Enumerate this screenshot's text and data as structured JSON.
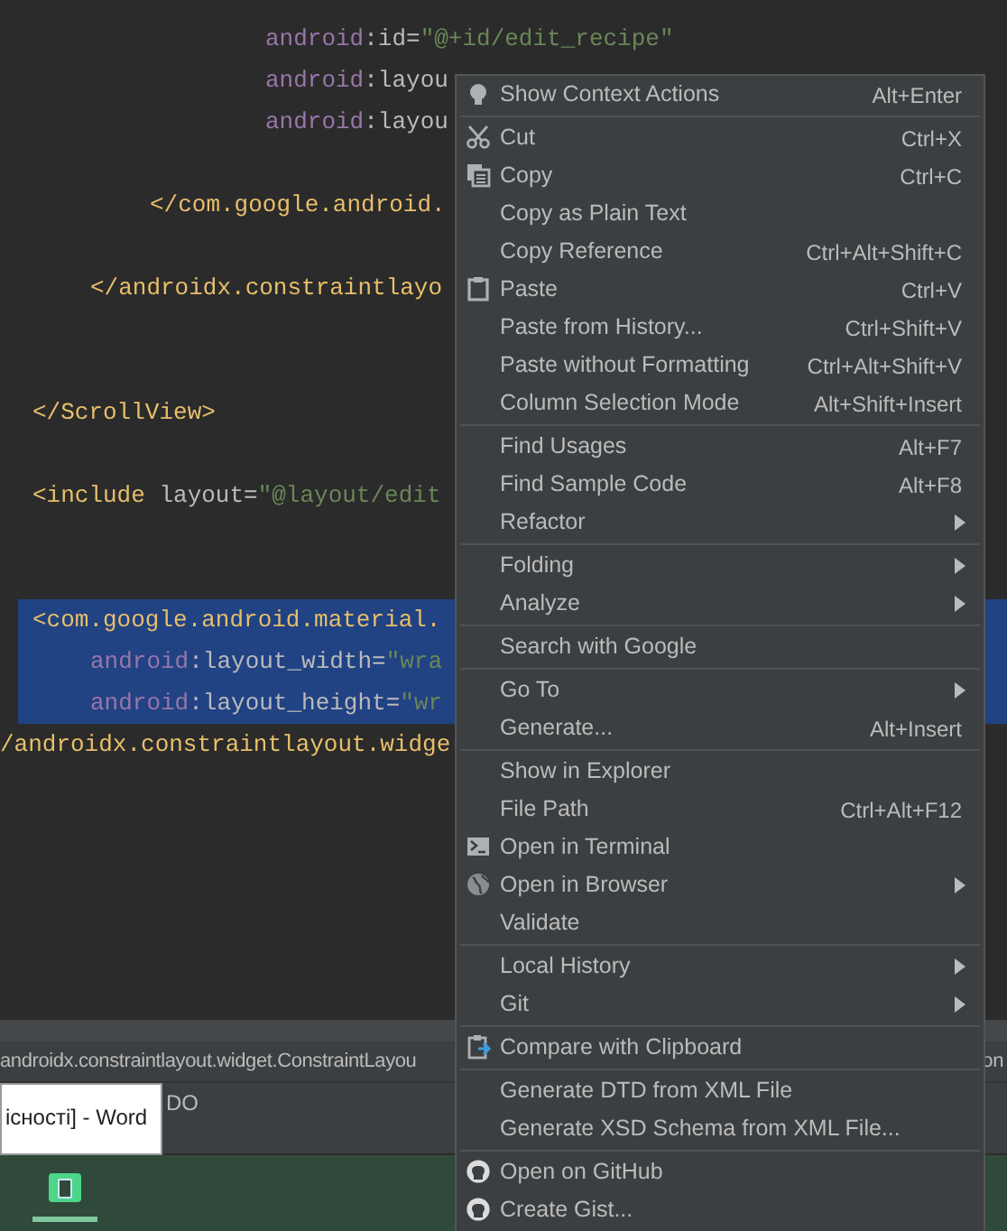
{
  "editor": {
    "lines": [
      {
        "tokens": [
          {
            "kind": "ns",
            "text": "android"
          },
          {
            "kind": "attr",
            "text": ":id="
          },
          {
            "kind": "value",
            "text": "\"@+id/edit_recipe\""
          }
        ],
        "selected": false
      },
      {
        "tokens": [
          {
            "kind": "ns",
            "text": "android"
          },
          {
            "kind": "attr",
            "text": ":layou"
          }
        ],
        "selected": false
      },
      {
        "tokens": [
          {
            "kind": "ns",
            "text": "android"
          },
          {
            "kind": "attr",
            "text": ":layou"
          }
        ],
        "selected": false
      },
      {
        "tokens": [
          {
            "kind": "tag",
            "text": "</com.google.android."
          }
        ],
        "selected": false
      },
      {
        "tokens": [
          {
            "kind": "tag",
            "text": "</androidx.constraintlayo"
          }
        ],
        "selected": false
      },
      {
        "tokens": [
          {
            "kind": "tag",
            "text": "</ScrollView>"
          }
        ],
        "selected": false
      },
      {
        "tokens": [
          {
            "kind": "tag",
            "text": "<include "
          },
          {
            "kind": "attr",
            "text": "layout="
          },
          {
            "kind": "value",
            "text": "\"@layout/edit"
          }
        ],
        "selected": false
      },
      {
        "tokens": [
          {
            "kind": "tag",
            "text": "<com.google.android.material."
          }
        ],
        "selected": true
      },
      {
        "tokens": [
          {
            "kind": "ns",
            "text": "android"
          },
          {
            "kind": "attr",
            "text": ":layout_width="
          },
          {
            "kind": "value",
            "text": "\"wra"
          }
        ],
        "selected": true
      },
      {
        "tokens": [
          {
            "kind": "ns",
            "text": "android"
          },
          {
            "kind": "attr",
            "text": ":layout_height="
          },
          {
            "kind": "value",
            "text": "\"wr"
          }
        ],
        "selected": true
      },
      {
        "tokens": [
          {
            "kind": "tag",
            "text": "/androidx.constraintlayout.widge"
          }
        ],
        "selected": false
      }
    ]
  },
  "breadcrumb": {
    "path": "androidx.constraintlayout.widget.ConstraintLayou",
    "tail": "on"
  },
  "tool_bar": {
    "label": "DO"
  },
  "tooltip": {
    "text": "існості] - Word"
  },
  "context_menu": {
    "sections": [
      [
        {
          "label": "Show Context Actions",
          "shortcut": "Alt+Enter",
          "submenu": false
        }
      ],
      [
        {
          "label": "Cut",
          "shortcut": "Ctrl+X",
          "submenu": false
        },
        {
          "label": "Copy",
          "shortcut": "Ctrl+C",
          "submenu": false
        },
        {
          "label": "Copy as Plain Text",
          "submenu": false
        },
        {
          "label": "Copy Reference",
          "shortcut": "Ctrl+Alt+Shift+C",
          "submenu": false
        },
        {
          "label": "Paste",
          "shortcut": "Ctrl+V",
          "submenu": false
        },
        {
          "label": "Paste from History...",
          "shortcut": "Ctrl+Shift+V",
          "submenu": false
        },
        {
          "label": "Paste without Formatting",
          "shortcut": "Ctrl+Alt+Shift+V",
          "submenu": false
        },
        {
          "label": "Column Selection Mode",
          "shortcut": "Alt+Shift+Insert",
          "submenu": false
        }
      ],
      [
        {
          "label": "Find Usages",
          "shortcut": "Alt+F7",
          "submenu": false
        },
        {
          "label": "Find Sample Code",
          "shortcut": "Alt+F8",
          "submenu": false
        },
        {
          "label": "Refactor",
          "submenu": true
        }
      ],
      [
        {
          "label": "Folding",
          "submenu": true
        },
        {
          "label": "Analyze",
          "submenu": true
        }
      ],
      [
        {
          "label": "Search with Google",
          "submenu": false
        }
      ],
      [
        {
          "label": "Go To",
          "submenu": true
        },
        {
          "label": "Generate...",
          "shortcut": "Alt+Insert",
          "submenu": false
        }
      ],
      [
        {
          "label": "Show in Explorer",
          "submenu": false
        },
        {
          "label": "File Path",
          "shortcut": "Ctrl+Alt+F12",
          "submenu": false
        },
        {
          "label": "Open in Terminal",
          "submenu": false
        },
        {
          "label": "Open in Browser",
          "submenu": true
        },
        {
          "label": "Validate",
          "submenu": false
        }
      ],
      [
        {
          "label": "Local History",
          "submenu": true
        },
        {
          "label": "Git",
          "submenu": true
        }
      ],
      [
        {
          "label": "Compare with Clipboard",
          "submenu": false
        }
      ],
      [
        {
          "label": "Generate DTD from XML File",
          "submenu": false
        },
        {
          "label": "Generate XSD Schema from XML File...",
          "submenu": false
        }
      ],
      [
        {
          "label": "Open on GitHub",
          "submenu": false
        },
        {
          "label": "Create Gist...",
          "submenu": false
        }
      ]
    ]
  }
}
